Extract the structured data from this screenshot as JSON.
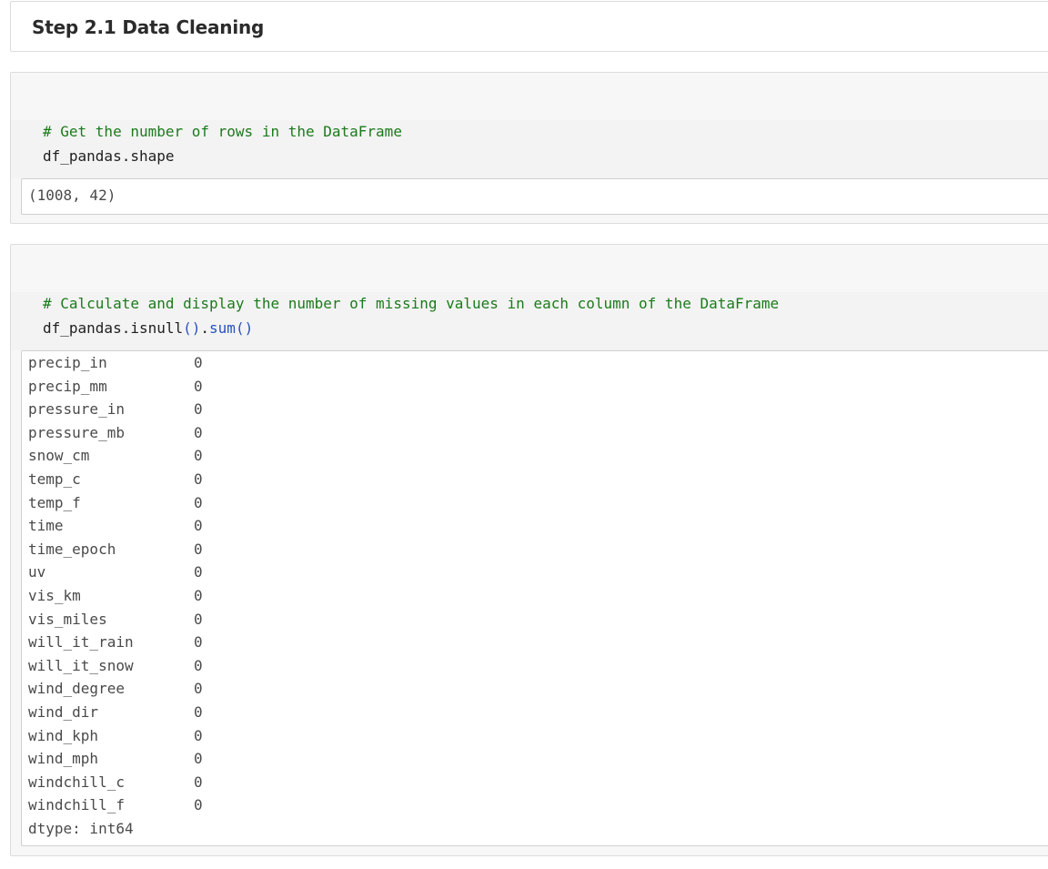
{
  "markdown_cell": {
    "heading": "Step 2.1 Data Cleaning"
  },
  "cell_1": {
    "code_comment": "# Get the number of rows in the DataFrame",
    "code_line": "df_pandas.shape",
    "output": "(1008, 42)"
  },
  "cell_2": {
    "code_comment": "# Calculate and display the number of missing values in each column of the DataFrame",
    "code_prefix": "df_pandas.isnull",
    "code_paren1": "()",
    "code_dot": ".",
    "code_call": "sum",
    "code_paren2": "()",
    "output_rows": [
      {
        "name": "precip_in",
        "value": "0"
      },
      {
        "name": "precip_mm",
        "value": "0"
      },
      {
        "name": "pressure_in",
        "value": "0"
      },
      {
        "name": "pressure_mb",
        "value": "0"
      },
      {
        "name": "snow_cm",
        "value": "0"
      },
      {
        "name": "temp_c",
        "value": "0"
      },
      {
        "name": "temp_f",
        "value": "0"
      },
      {
        "name": "time",
        "value": "0"
      },
      {
        "name": "time_epoch",
        "value": "0"
      },
      {
        "name": "uv",
        "value": "0"
      },
      {
        "name": "vis_km",
        "value": "0"
      },
      {
        "name": "vis_miles",
        "value": "0"
      },
      {
        "name": "will_it_rain",
        "value": "0"
      },
      {
        "name": "will_it_snow",
        "value": "0"
      },
      {
        "name": "wind_degree",
        "value": "0"
      },
      {
        "name": "wind_dir",
        "value": "0"
      },
      {
        "name": "wind_kph",
        "value": "0"
      },
      {
        "name": "wind_mph",
        "value": "0"
      },
      {
        "name": "windchill_c",
        "value": "0"
      },
      {
        "name": "windchill_f",
        "value": "0"
      }
    ],
    "dtype_line": "dtype: int64"
  },
  "colors": {
    "comment": "#1c7a1c",
    "paren": "#2a52be",
    "cell_border": "#dcdcdc",
    "cell_background": "#f7f7f7"
  }
}
